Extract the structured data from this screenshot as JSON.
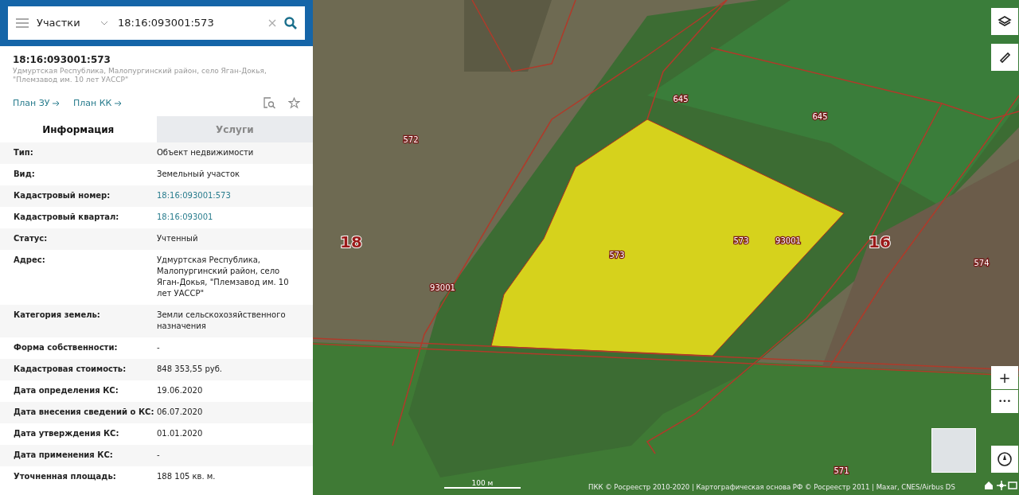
{
  "search": {
    "layer": "Участки",
    "value": "18:16:093001:573"
  },
  "object": {
    "title": "18:16:093001:573",
    "address": "Удмуртская Республика, Малопургинский район, село Яган-Докья, \"Племзавод им. 10 лет УАССР\"",
    "links": [
      "План ЗУ",
      "План КК"
    ]
  },
  "tabs": [
    {
      "label": "Информация",
      "selected": true
    },
    {
      "label": "Услуги",
      "selected": false
    }
  ],
  "rows": [
    {
      "label": "Тип:",
      "value": "Объект недвижимости",
      "kind": "text"
    },
    {
      "label": "Вид:",
      "value": "Земельный участок",
      "kind": "text"
    },
    {
      "label": "Кадастровый номер:",
      "value": "18:16:093001:573",
      "kind": "link"
    },
    {
      "label": "Кадастровый квартал:",
      "value": "18:16:093001",
      "kind": "link"
    },
    {
      "label": "Статус:",
      "value": "Учтенный",
      "kind": "text"
    },
    {
      "label": "Адрес:",
      "value": "Удмуртская Республика, Малопургинский район, село Яган-Докья, \"Племзавод им. 10 лет УАССР\"",
      "kind": "text"
    },
    {
      "label": "Категория земель:",
      "value": "Земли сельскохозяйственного назначения",
      "kind": "text"
    },
    {
      "label": "Форма собственности:",
      "value": "-",
      "kind": "text"
    },
    {
      "label": "Кадастровая стоимость:",
      "value": "848 353,55 руб.",
      "kind": "text"
    },
    {
      "label": "Дата определения КС:",
      "value": "19.06.2020",
      "kind": "text"
    },
    {
      "label": "Дата внесения сведений о КС:",
      "value": "06.07.2020",
      "kind": "text"
    },
    {
      "label": "Дата утверждения КС:",
      "value": "01.01.2020",
      "kind": "text"
    },
    {
      "label": "Дата применения КС:",
      "value": "-",
      "kind": "text"
    },
    {
      "label": "Уточненная площадь:",
      "value": "188 105 кв. м.",
      "kind": "text"
    }
  ],
  "map": {
    "labels": [
      "645",
      "645",
      "572",
      "18",
      "573",
      "573",
      "93001",
      "16",
      "574",
      "93001",
      "571"
    ],
    "controls": {
      "zoom_in": "+",
      "more": "•••"
    },
    "scale": "100 м",
    "attribution": "ПКК © Росреестр 2010-2020 | Картографическая основа РФ © Росреестр 2011 | Maxar, CNES/Airbus DS"
  }
}
